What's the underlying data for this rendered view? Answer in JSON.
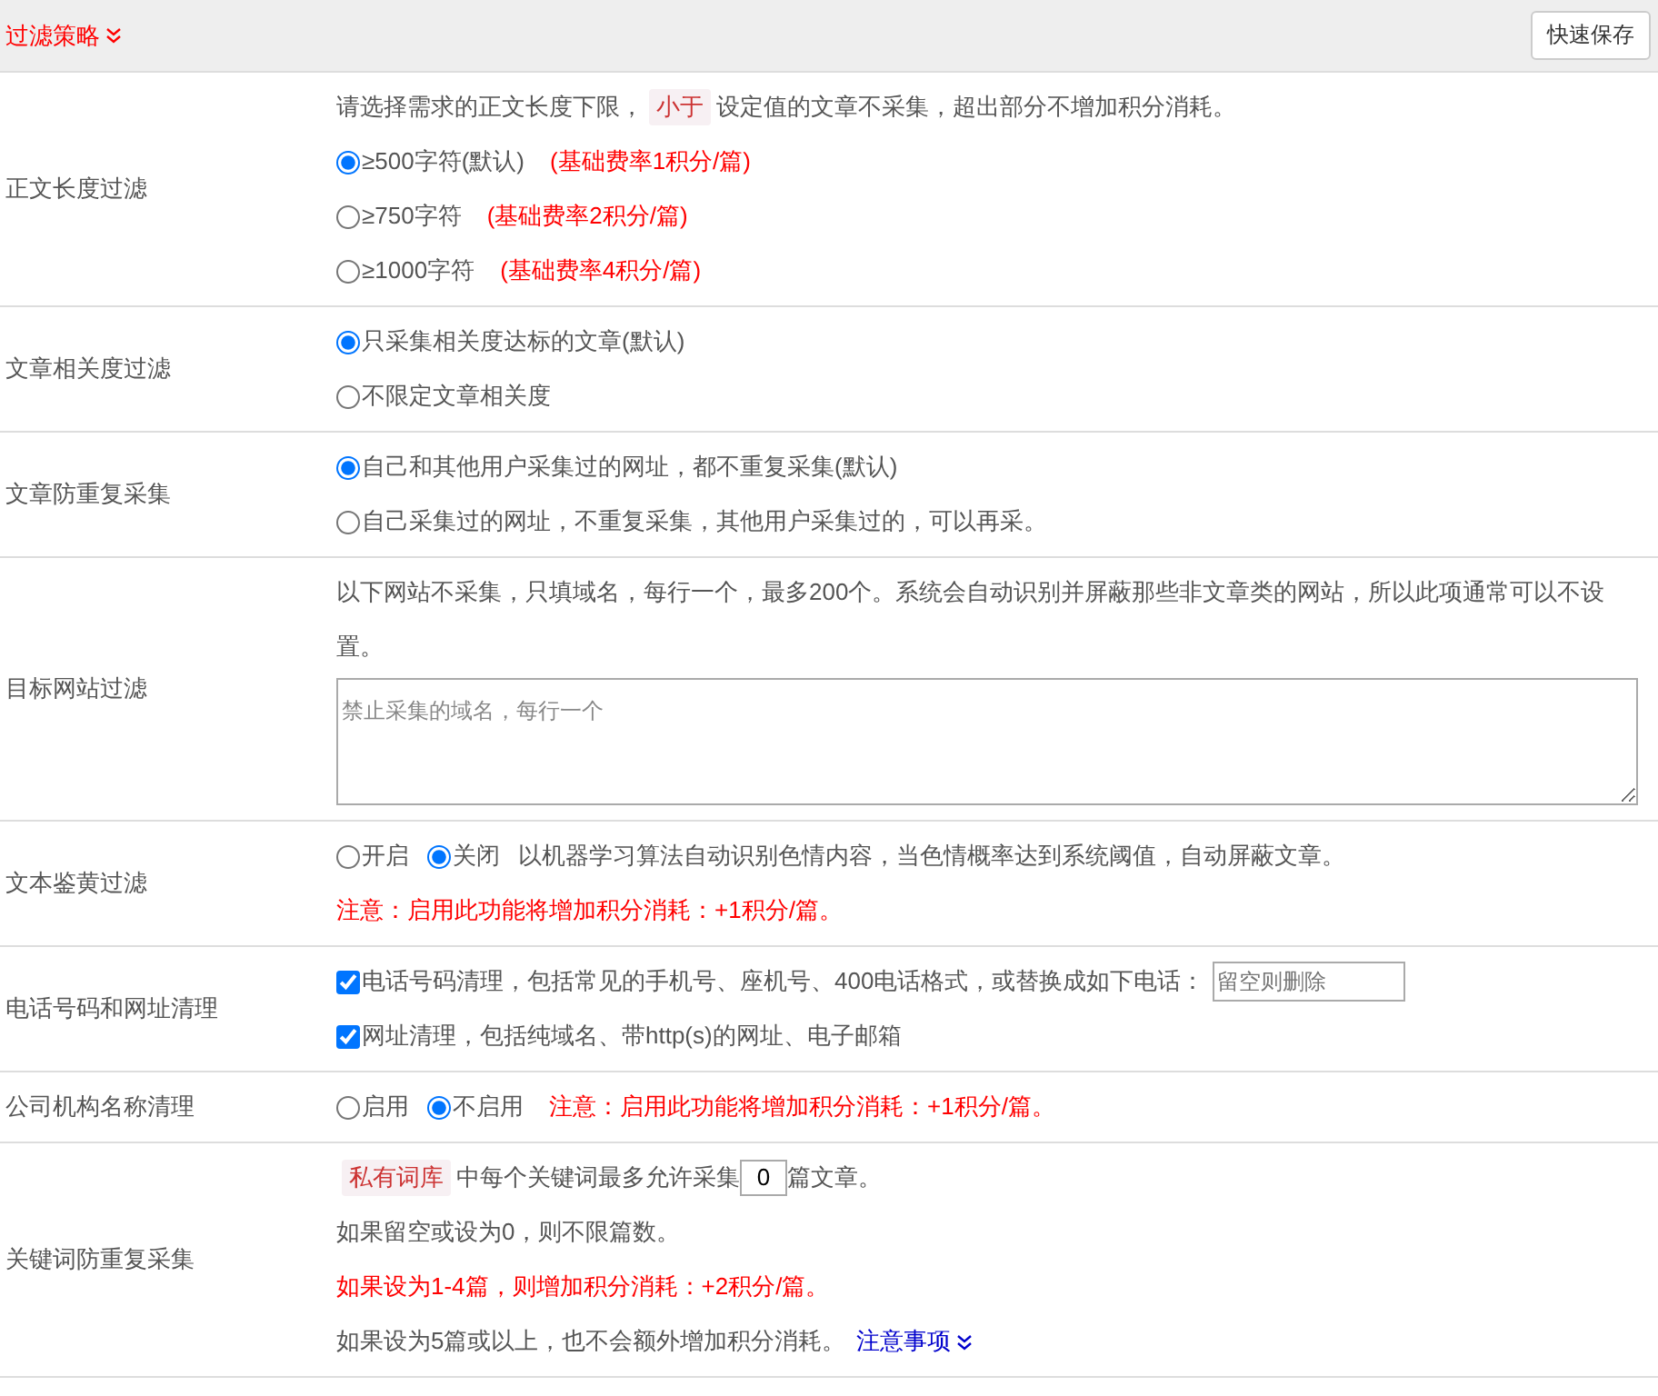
{
  "header": {
    "title": "过滤策略",
    "save_button": "快速保存"
  },
  "sections": [
    {
      "label": "正文长度过滤",
      "lines": [
        [
          {
            "kind": "text",
            "text": "请选择需求的正文长度下限，"
          },
          {
            "kind": "tag",
            "text": "小于"
          },
          {
            "kind": "text",
            "text": "设定值的文章不采集，超出部分不增加积分消耗。"
          }
        ],
        [
          {
            "kind": "radio",
            "label": "≥500字符(默认)",
            "selected": true
          },
          {
            "kind": "note",
            "text": "(基础费率1积分/篇)"
          }
        ],
        [
          {
            "kind": "radio",
            "label": "≥750字符",
            "selected": false
          },
          {
            "kind": "note",
            "text": "(基础费率2积分/篇)"
          }
        ],
        [
          {
            "kind": "radio",
            "label": "≥1000字符",
            "selected": false
          },
          {
            "kind": "note",
            "text": "(基础费率4积分/篇)"
          }
        ]
      ]
    },
    {
      "label": "文章相关度过滤",
      "lines": [
        [
          {
            "kind": "radio",
            "label": "只采集相关度达标的文章(默认)",
            "selected": true
          }
        ],
        [
          {
            "kind": "radio",
            "label": "不限定文章相关度",
            "selected": false
          }
        ]
      ]
    },
    {
      "label": "文章防重复采集",
      "lines": [
        [
          {
            "kind": "radio",
            "label": "自己和其他用户采集过的网址，都不重复采集(默认)",
            "selected": true
          }
        ],
        [
          {
            "kind": "radio",
            "label": "自己采集过的网址，不重复采集，其他用户采集过的，可以再采。",
            "selected": false
          }
        ]
      ]
    },
    {
      "label": "目标网站过滤",
      "lines": [
        [
          {
            "kind": "text",
            "text": "以下网站不采集，只填域名，每行一个，最多200个。系统会自动识别并屏蔽那些非文章类的网站，所以此项通常可以不设置。"
          }
        ],
        [
          {
            "kind": "textarea",
            "placeholder": "禁止采集的域名，每行一个"
          }
        ]
      ]
    },
    {
      "label": "文本鉴黄过滤",
      "lines": [
        [
          {
            "kind": "radio",
            "label": "开启",
            "selected": false
          },
          {
            "kind": "radio",
            "label": "关闭",
            "selected": true
          },
          {
            "kind": "text",
            "text": "以机器学习算法自动识别色情内容，当色情概率达到系统阈值，自动屏蔽文章。"
          }
        ],
        [
          {
            "kind": "note",
            "text": "注意：启用此功能将增加积分消耗：+1积分/篇。"
          }
        ]
      ]
    },
    {
      "label": "电话号码和网址清理",
      "lines": [
        [
          {
            "kind": "checkbox",
            "label": "电话号码清理，包括常见的手机号、座机号、400电话格式，或替换成如下电话：",
            "checked": true
          },
          {
            "kind": "input",
            "placeholder": "留空则删除"
          }
        ],
        [
          {
            "kind": "checkbox",
            "label": "网址清理，包括纯域名、带http(s)的网址、电子邮箱",
            "checked": true
          }
        ]
      ]
    },
    {
      "label": "公司机构名称清理",
      "lines": [
        [
          {
            "kind": "radio",
            "label": "启用",
            "selected": false
          },
          {
            "kind": "radio",
            "label": "不启用",
            "selected": true
          },
          {
            "kind": "note",
            "text": "注意：启用此功能将增加积分消耗：+1积分/篇。"
          }
        ]
      ]
    },
    {
      "label": "关键词防重复采集",
      "lines": [
        [
          {
            "kind": "tag",
            "text": "私有词库"
          },
          {
            "kind": "text",
            "text": "中每个关键词最多允许采集"
          },
          {
            "kind": "number",
            "value": "0"
          },
          {
            "kind": "text",
            "text": "篇文章。"
          }
        ],
        [
          {
            "kind": "text",
            "text": "如果留空或设为0，则不限篇数。"
          }
        ],
        [
          {
            "kind": "note",
            "text": "如果设为1-4篇，则增加积分消耗：+2积分/篇。"
          }
        ],
        [
          {
            "kind": "text",
            "text": "如果设为5篇或以上，也不会额外增加积分消耗。"
          },
          {
            "kind": "link",
            "text": "注意事项"
          }
        ]
      ]
    }
  ]
}
